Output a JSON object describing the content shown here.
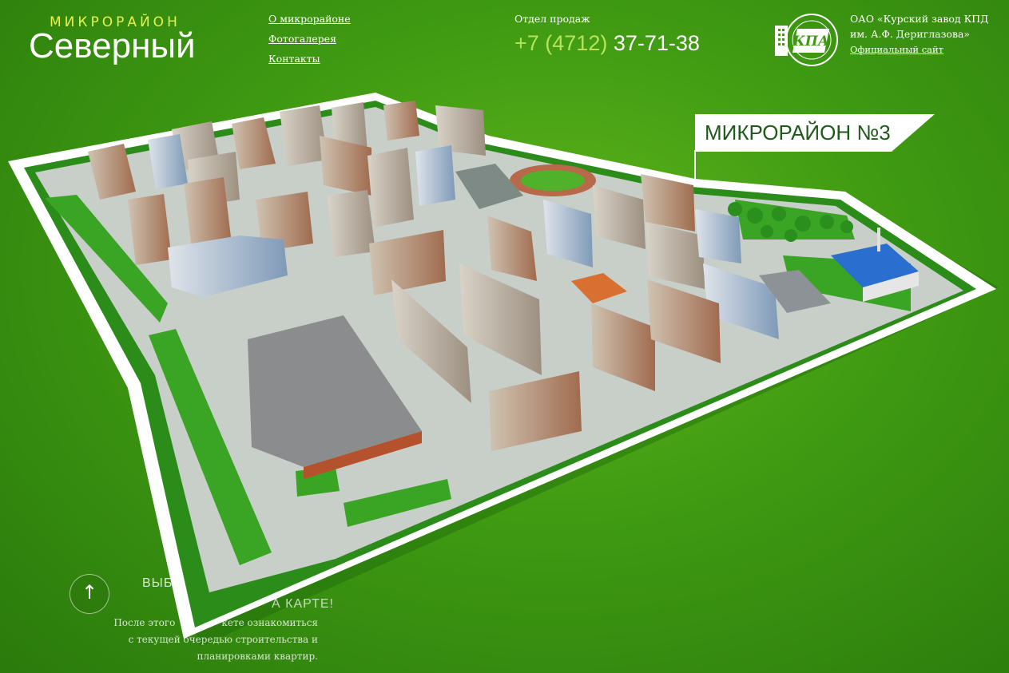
{
  "brand": {
    "subtitle": "МИКРОРАЙОН",
    "title": "Северный"
  },
  "nav": [
    {
      "label": "О микрорайоне"
    },
    {
      "label": "Фотогалерея"
    },
    {
      "label": "Контакты"
    }
  ],
  "sales": {
    "label": "Отдел продаж",
    "phone_code": "+7 (4712)",
    "phone_number": "37-71-38"
  },
  "company": {
    "name_line1": "ОАО «Курский завод КПД",
    "name_line2": "им. А.Ф. Дериглазова»",
    "site_link": "Официальный сайт",
    "logo_text": "КПА"
  },
  "map": {
    "district_label": "МИКРОРАЙОН №3"
  },
  "cta": {
    "title_visible": "ВЫБ",
    "title_visible2": "А КАРТЕ!",
    "text_line1": "После этого",
    "text_line1b": "кете ознакомиться",
    "text_line2": "с текущей очередью строительства и",
    "text_line3": "планировками квартир."
  },
  "colors": {
    "background": "#3f9a12",
    "accent_yellow": "#e9f24a",
    "phone_code": "#b5e35a",
    "label_text": "#1f5a1a"
  }
}
